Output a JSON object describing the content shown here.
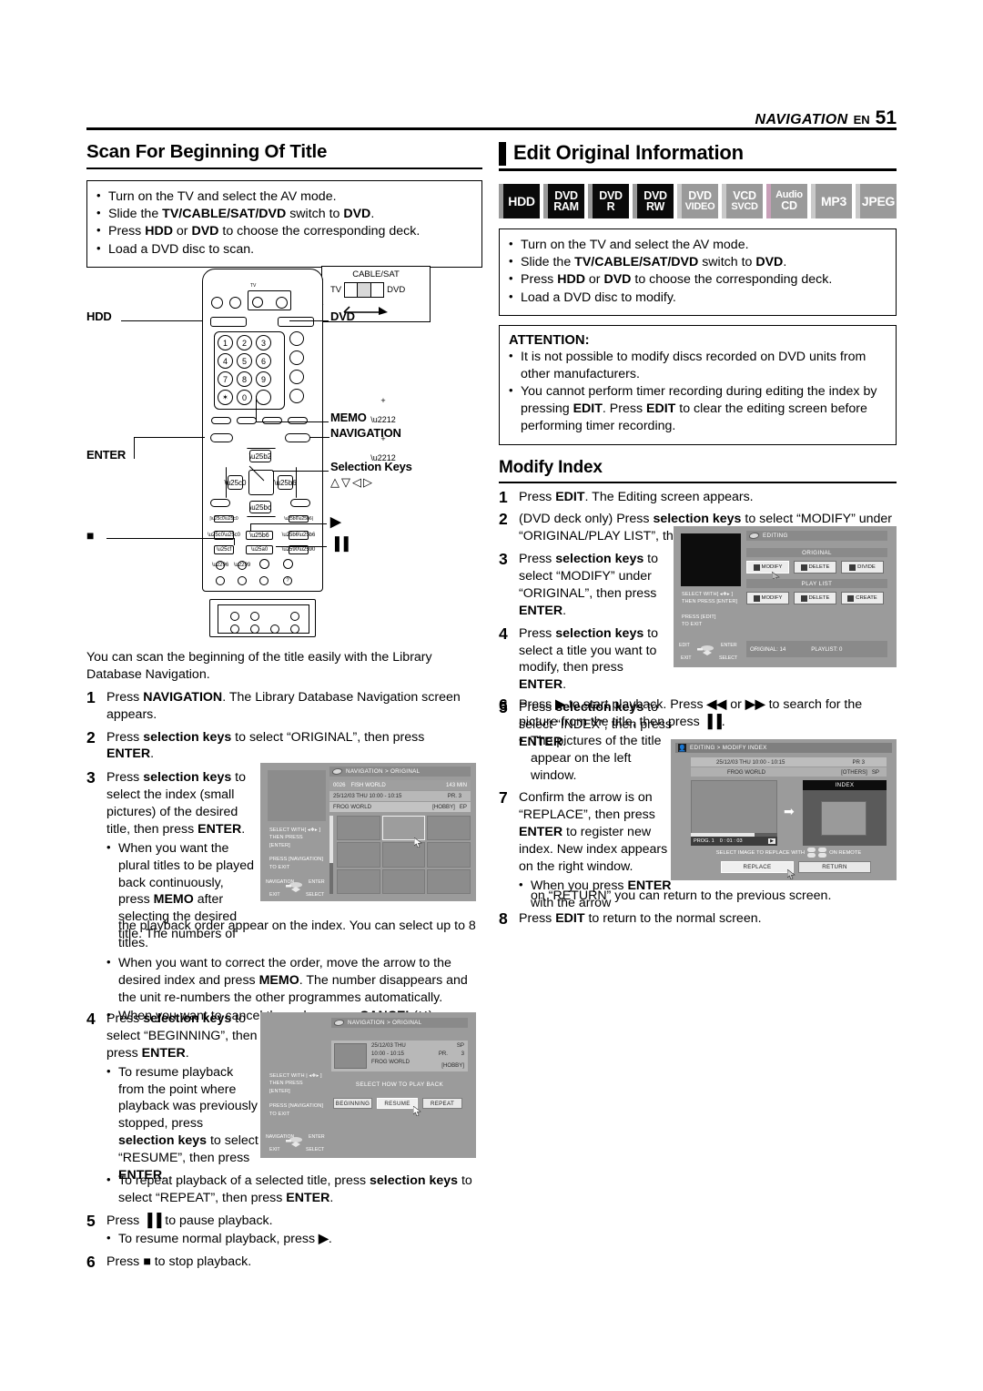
{
  "header": {
    "section": "NAVIGATION",
    "lang": "EN",
    "page": "51"
  },
  "left_column": {
    "title": "Scan For Beginning Of Title",
    "prep_box": [
      "Turn on the TV and select the AV mode.",
      "Slide the TV/CABLE/SAT/DVD switch to DVD.",
      "Press HDD or DVD to choose the corresponding deck.",
      "Load a DVD disc to scan."
    ],
    "remote": {
      "switch_callout": {
        "top": "CABLE/SAT",
        "left": "TV",
        "right": "DVD"
      },
      "labels": {
        "hdd": "HDD",
        "dvd": "DVD",
        "memo": "MEMO",
        "navigation": "NAVIGATION",
        "enter": "ENTER",
        "selection_keys": "Selection Keys",
        "selection_glyphs": "△▽◁▷"
      },
      "keypad": [
        "1",
        "2",
        "3",
        "4",
        "5",
        "6",
        "7",
        "8",
        "9",
        "✶",
        "0"
      ],
      "transport_labels": {
        "play": "▶",
        "stop": "■",
        "pause": "▐▐"
      }
    },
    "intro": "You can scan the beginning of the title easily with the Library Database Navigation.",
    "steps": [
      {
        "n": "1",
        "html": "Press <b>NAVIGATION</b>. The Library Database Navigation screen appears."
      },
      {
        "n": "2",
        "html": "Press <b>selection keys</b> to select “ORIGINAL”, then press <b>ENTER</b>."
      },
      {
        "n": "3",
        "html": "Press <b>selection keys</b> to select the index (small pictures) of the desired title, then press <b>ENTER</b>."
      }
    ],
    "step3_bullets": [
      "When you want the plural titles to be played back continuously, press MEMO after selecting the desired title. The numbers of the playback order appear on the index. You can select up to 8 titles.",
      "When you want to correct the order, move the arrow to the desired index and press MEMO. The number disappears and the unit re-numbers the other programmes automatically.",
      "When you want to cancel the order, press CANCEL(✕)."
    ],
    "step4": {
      "n": "4",
      "html": "Press <b>selection keys</b> to select “BEGINNING”, then press <b>ENTER</b>."
    },
    "step4_bullets": [
      "To resume playback from the point where playback was previously stopped, press selection keys to select “RESUME”, then press ENTER.",
      "To repeat playback of a selected title, press selection keys to select “REPEAT”, then press ENTER."
    ],
    "steps_tail": [
      {
        "n": "5",
        "html": "Press <b>▐▐</b> to pause playback."
      },
      {
        "n": "6",
        "html": "Press <b>■</b> to stop playback."
      }
    ],
    "step5_bullet": "To resume normal playback, press ▶.",
    "osd_navigation": {
      "title": "NAVIGATION > ORIGINAL",
      "row1": {
        "num": "0026",
        "name": "FISH WORLD",
        "time": "143 MIN"
      },
      "row2": {
        "date": "25/12/03 THU 10:00 - 10:15",
        "pr": "PR. 3"
      },
      "row3": {
        "name": "FROG WORLD",
        "genre": "[HOBBY]",
        "mode": "EP"
      },
      "left_panel": [
        "SELECT WITH[ ◂❖▸ ]",
        "THEN PRESS [ENTER]",
        "",
        "PRESS [NAVIGATION]",
        "TO EXIT"
      ],
      "nav_hints": {
        "left": "NAVIGATION",
        "right": "ENTER",
        "bl": "EXIT",
        "br": "SELECT"
      }
    },
    "osd_playback": {
      "title": "NAVIGATION > ORIGINAL",
      "info": {
        "date": "25/12/03 THU",
        "time": "10:00 - 10:15",
        "pr": "PR.",
        "prnum": "3",
        "mode": "SP",
        "name": "FROG WORLD",
        "genre": "[HOBBY]"
      },
      "prompt": "SELECT HOW TO PLAY BACK",
      "buttons": [
        "BEGINNING",
        "RESUME",
        "REPEAT"
      ],
      "left_panel": [
        "SELECT WITH | ◂❖▸ ]",
        "THEN PRESS [ENTER]",
        "",
        "PRESS [NAVIGATION]",
        "TO EXIT"
      ],
      "nav_hints": {
        "left": "NAVIGATION",
        "right": "ENTER",
        "bl": "EXIT",
        "br": "SELECT"
      }
    }
  },
  "right_column": {
    "title": "Edit Original Information",
    "media_badges": [
      {
        "lines": [
          "HDD"
        ],
        "state": "on"
      },
      {
        "lines": [
          "DVD",
          "RAM"
        ],
        "state": "on"
      },
      {
        "lines": [
          "DVD",
          "R"
        ],
        "state": "on"
      },
      {
        "lines": [
          "DVD",
          "RW"
        ],
        "state": "on"
      },
      {
        "lines": [
          "DVD",
          "VIDEO"
        ],
        "state": "off"
      },
      {
        "lines": [
          "VCD",
          "SVCD"
        ],
        "state": "off"
      },
      {
        "lines": [
          "Audio",
          "CD"
        ],
        "state": "off"
      },
      {
        "lines": [
          "MP3"
        ],
        "state": "off"
      },
      {
        "lines": [
          "JPEG"
        ],
        "state": "off"
      }
    ],
    "prep_box": [
      "Turn on the TV and select the AV mode.",
      "Slide the TV/CABLE/SAT/DVD switch to DVD.",
      "Press HDD or DVD to choose the corresponding deck.",
      "Load a DVD disc to modify."
    ],
    "attention": {
      "title": "ATTENTION:",
      "items": [
        "It is not possible to modify discs recorded on DVD units from other manufacturers.",
        "You cannot perform timer recording during editing the index by pressing EDIT. Press EDIT to clear the editing screen before performing timer recording."
      ]
    },
    "subtitle": "Modify Index",
    "steps": [
      {
        "n": "1",
        "html": "Press <b>EDIT</b>. The Editing screen appears."
      },
      {
        "n": "2",
        "html": "(DVD deck only) Press <b>selection keys</b> to select “MODIFY” under “ORIGINAL/PLAY LIST”, then press <b>ENTER</b>."
      },
      {
        "n": "3",
        "html": "Press <b>selection keys</b> to select “MODIFY” under “ORIGINAL”, then press <b>ENTER</b>."
      },
      {
        "n": "4",
        "html": "Press <b>selection keys</b> to select a title you want to modify, then press <b>ENTER</b>."
      },
      {
        "n": "5",
        "html": "Press <b>selection keys</b> to select “INDEX”, then press <b>ENTER</b>."
      },
      {
        "n": "6",
        "html": "Press <b>▶</b> to start playback. Press <b>◀◀</b> or <b>▶▶</b> to search for the picture from the title, then press <b>▐▐</b>."
      },
      {
        "n": "7",
        "html": "Confirm the arrow is on “REPLACE”, then press <b>ENTER</b> to register new index. New index appears on the right window."
      },
      {
        "n": "8",
        "html": "Press <b>EDIT</b> to return to the normal screen."
      }
    ],
    "step6_bullet": "The pictures of the title appear on the left window.",
    "step7_bullet": "When you press ENTER with the arrow on “RETURN” you can return to the previous screen.",
    "osd_editing": {
      "title": "EDITING",
      "group_original": "ORIGINAL",
      "original_buttons": [
        "MODIFY",
        "DELETE",
        "DIVIDE"
      ],
      "group_playlist": "PLAY LIST",
      "playlist_buttons": [
        "MODIFY",
        "DELETE",
        "CREATE"
      ],
      "left_panel": [
        "SELECT WITH[ ◂❖▸ ]",
        "THEN PRESS [ENTER]",
        "",
        "PRESS [EDIT]",
        "TO EXIT"
      ],
      "nav_hints": {
        "left": "EDIT",
        "right": "ENTER",
        "bl": "EXIT",
        "br": "SELECT"
      },
      "status": {
        "original": "ORIGINAL: 14",
        "playlist": "PLAYLIST: 0"
      }
    },
    "osd_modify_index": {
      "title": "EDITING > MODIFY INDEX",
      "info_row1": {
        "date": "25/12/03 THU 10:00 - 10:15",
        "pr": "PR  3"
      },
      "info_row2": {
        "name": "FROG WORLD",
        "genre": "[OTHERS]",
        "mode": "SP"
      },
      "index_label": "INDEX",
      "progress": {
        "prog": "PROG. 1",
        "time": "0 : 01 : 03"
      },
      "hint": "SELECT IMAGE TO REPLACE WITH",
      "hint_tail": "ON REMOTE",
      "buttons": [
        "REPLACE",
        "RETURN"
      ]
    }
  }
}
